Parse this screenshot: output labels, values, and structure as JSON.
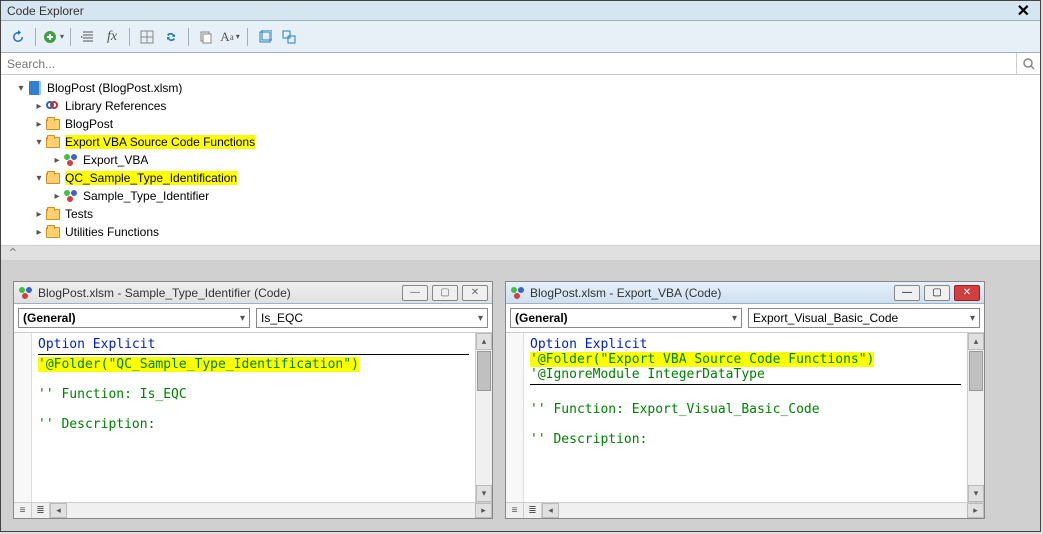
{
  "window": {
    "title": "Code Explorer"
  },
  "search": {
    "placeholder": "Search..."
  },
  "tree": {
    "root": {
      "label": "BlogPost (BlogPost.xlsm)"
    },
    "libref": {
      "label": "Library References"
    },
    "blogpost": {
      "label": "BlogPost"
    },
    "exportFolder": {
      "label": "Export VBA Source Code Functions"
    },
    "exportVba": {
      "label": "Export_VBA"
    },
    "qcFolder": {
      "label": "QC_Sample_Type_Identification"
    },
    "sampleType": {
      "label": "Sample_Type_Identifier"
    },
    "tests": {
      "label": "Tests"
    },
    "util": {
      "label": "Utilities Functions"
    }
  },
  "windowLeft": {
    "title": "BlogPost.xlsm - Sample_Type_Identifier (Code)",
    "comboObject": "(General)",
    "comboProc": "Is_EQC",
    "code": {
      "l1": "Option Explicit",
      "l2": "'@Folder(\"QC_Sample_Type_Identification\")",
      "l3": "'' Function: Is_EQC",
      "l4": "'' Description:"
    }
  },
  "windowRight": {
    "title": "BlogPost.xlsm - Export_VBA (Code)",
    "comboObject": "(General)",
    "comboProc": "Export_Visual_Basic_Code",
    "code": {
      "l1": "Option Explicit",
      "l2": "'@Folder(\"Export VBA Source Code Functions\")",
      "l3": "'@IgnoreModule IntegerDataType",
      "l4": "'' Function: Export_Visual_Basic_Code",
      "l5": "'' Description:"
    }
  }
}
